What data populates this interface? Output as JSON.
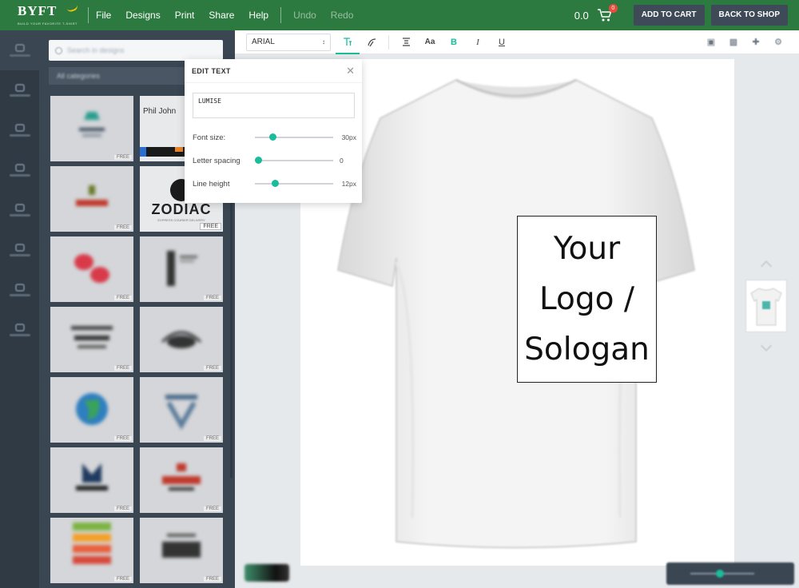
{
  "app": {
    "logo_text": "BYFT",
    "logo_tagline": "BUILD YOUR FAVORITE T-SHIRT"
  },
  "menu": {
    "file": "File",
    "designs": "Designs",
    "print": "Print",
    "share": "Share",
    "help": "Help",
    "undo": "Undo",
    "redo": "Redo"
  },
  "header": {
    "price": "0.0",
    "cart_count": "0",
    "add_to_cart": "ADD TO CART",
    "back_to_shop": "BACK TO SHOP"
  },
  "sidebar": {
    "search_placeholder": "Search in designs",
    "category": "All categories",
    "tiles": [
      {
        "kind": "blurred",
        "free": "FREE"
      },
      {
        "kind": "phil",
        "name": "Phil John",
        "free": ""
      },
      {
        "kind": "blurred",
        "free": "FREE"
      },
      {
        "kind": "zodiac",
        "title": "ZODIAC",
        "sub": "EXPRESS COURIER DELIVERY",
        "free": "FREE"
      },
      {
        "kind": "blurred",
        "free": "FREE"
      },
      {
        "kind": "blurred",
        "free": "FREE"
      },
      {
        "kind": "blurred",
        "free": "FREE"
      },
      {
        "kind": "blurred",
        "free": "FREE"
      },
      {
        "kind": "blurred",
        "free": "FREE"
      },
      {
        "kind": "blurred",
        "free": "FREE"
      },
      {
        "kind": "blurred",
        "free": "FREE"
      },
      {
        "kind": "blurred",
        "free": "FREE"
      },
      {
        "kind": "blurred",
        "free": "FREE"
      },
      {
        "kind": "blurred",
        "free": "FREE"
      }
    ]
  },
  "toolbar": {
    "font_family": "ARIAL",
    "text_icon": "text-icon",
    "curve_icon": "curve-text-icon",
    "align_icon": "align-icon",
    "case_label": "Aa",
    "bold_label": "B",
    "italic_label": "I",
    "underline_label": "U"
  },
  "edit_text": {
    "title": "EDIT TEXT",
    "value": "LUMISE",
    "font_size_label": "Font size:",
    "font_size_value": "30px",
    "font_size_level": 0.22,
    "letter_spacing_label": "Letter spacing",
    "letter_spacing_value": "0",
    "letter_spacing_level": 0.04,
    "line_height_label": "Line height",
    "line_height_value": "12px",
    "line_height_level": 0.25
  },
  "canvas": {
    "design_text": "Your\nLogo /\nSologan"
  },
  "colors": {
    "brand_green": "#2d7a40",
    "accent_teal": "#1abc9c",
    "panel_dark": "#3a4652"
  }
}
